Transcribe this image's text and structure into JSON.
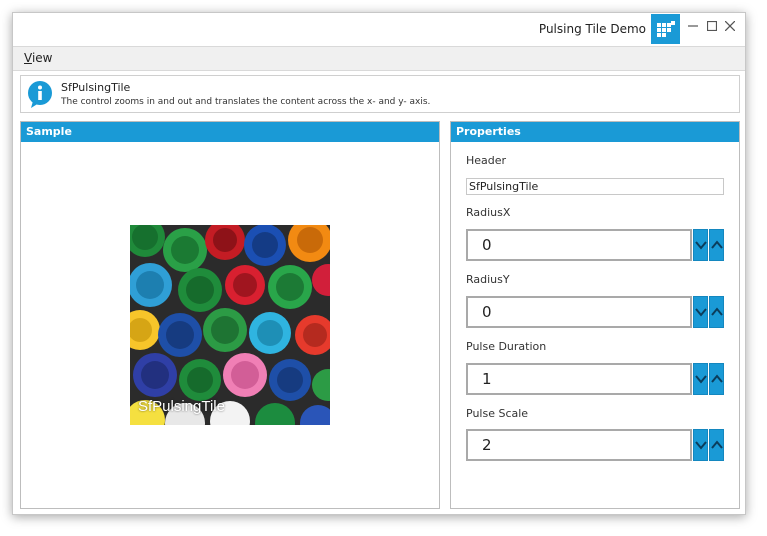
{
  "window": {
    "title": "Pulsing Tile Demo"
  },
  "menu": {
    "view_label": "View",
    "view_access_key": "V",
    "view_rest": "iew"
  },
  "info": {
    "title": "SfPulsingTile",
    "description": "The control zooms in and out and translates the content across the x- and y- axis."
  },
  "sample": {
    "header": "Sample",
    "tile_label": "SfPulsingTile"
  },
  "properties": {
    "header": "Properties",
    "header_label": "Header",
    "header_value": "SfPulsingTile",
    "radiusx_label": "RadiusX",
    "radiusx_value": "0",
    "radiusy_label": "RadiusY",
    "radiusy_value": "0",
    "duration_label": "Pulse Duration",
    "duration_value": "1",
    "scale_label": "Pulse Scale",
    "scale_value": "2"
  },
  "colors": {
    "accent": "#1a9ad6",
    "border": "#bdbdbd",
    "menu_bg": "#f0f0f0"
  },
  "icons": [
    "app-tile-icon",
    "minimize-icon",
    "maximize-icon",
    "close-icon",
    "info-icon",
    "chevron-down-icon",
    "chevron-up-icon"
  ]
}
